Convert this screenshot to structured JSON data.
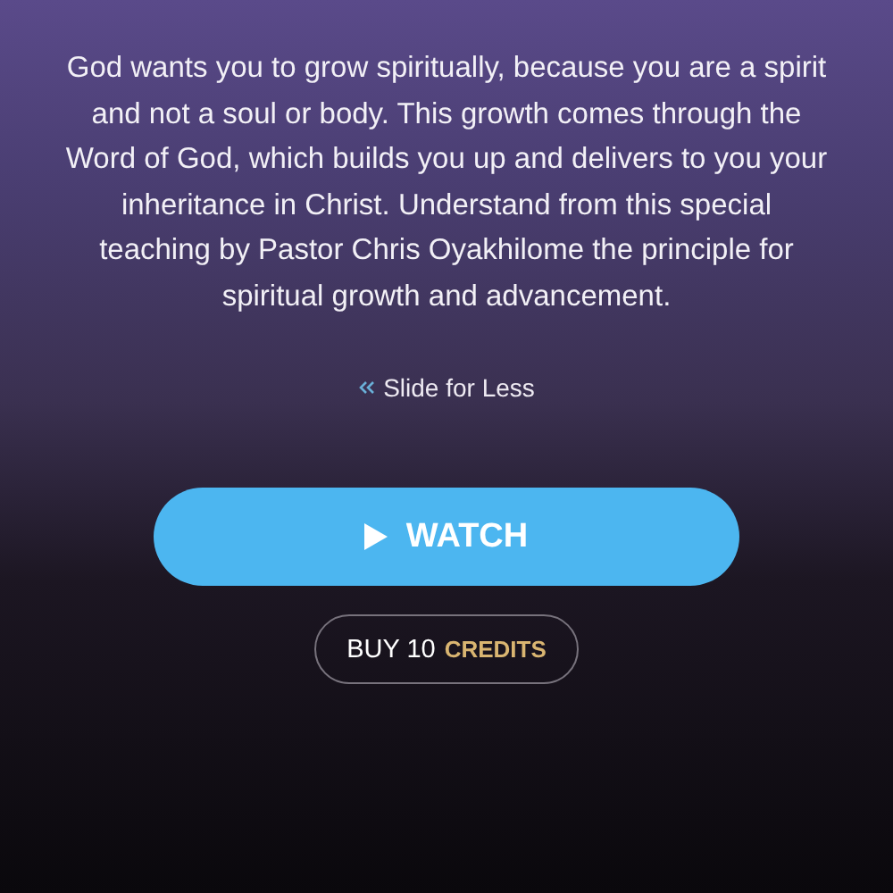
{
  "description": "God wants you to grow spiritually, because you are a spirit and not a soul or body. This growth comes through the Word of God, which builds you up and delivers to you your inheritance in Christ. Understand from this special teaching by Pastor Chris Oyakhilome the principle for spiritual growth and advancement.",
  "toggle": {
    "label": "Slide for Less"
  },
  "watch_button": {
    "label": "WATCH"
  },
  "buy_button": {
    "label": "BUY 10",
    "highlight": "CREDITS"
  }
}
